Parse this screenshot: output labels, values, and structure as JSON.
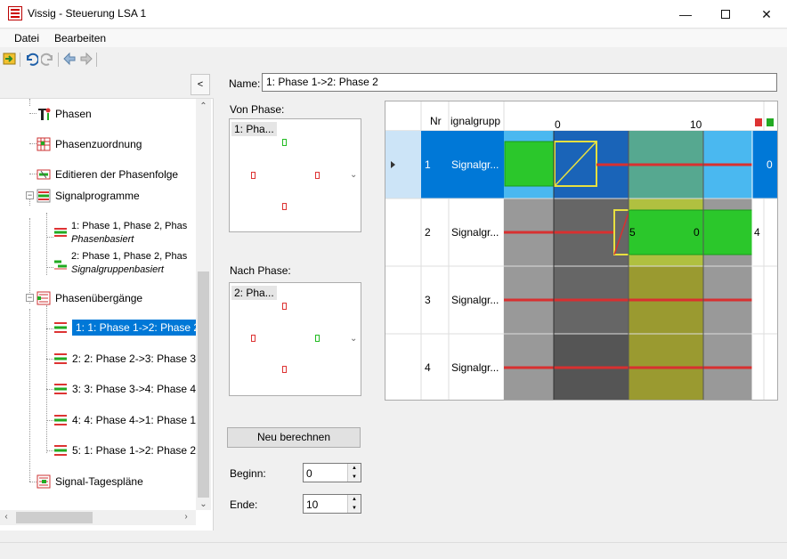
{
  "window": {
    "title": "Vissig - Steuerung LSA 1"
  },
  "menu": {
    "items": [
      "Datei",
      "Bearbeiten"
    ]
  },
  "toolbar": {
    "buttons": [
      "exit-icon",
      "undo-icon",
      "redo-icon",
      "back-icon",
      "forward-icon"
    ]
  },
  "left_panel": {
    "collapse_label": "<",
    "tree": [
      {
        "label": "Phasen"
      },
      {
        "label": "Phasenzuordnung"
      },
      {
        "label": "Editieren der Phasenfolge"
      },
      {
        "label": "Signalprogramme"
      },
      {
        "label": "1: Phase 1, Phase 2, Phas",
        "sub": "Phasenbasiert"
      },
      {
        "label": "2: Phase 1, Phase 2, Phas",
        "sub": "Signalgruppenbasiert"
      },
      {
        "label": "Phasenübergänge"
      },
      {
        "label": "1: 1: Phase 1->2: Phase 2",
        "selected": true
      },
      {
        "label": "2: 2: Phase 2->3: Phase 3"
      },
      {
        "label": "3: 3: Phase 3->4: Phase 4"
      },
      {
        "label": "4: 4: Phase 4->1: Phase 1"
      },
      {
        "label": "5: 1: Phase 1->2: Phase 2"
      },
      {
        "label": "Signal-Tagespläne"
      }
    ]
  },
  "editor": {
    "name_label": "Name:",
    "name_value": "1: Phase 1->2: Phase 2",
    "von_label": "Von Phase:",
    "von_title": "1: Pha...",
    "nach_label": "Nach Phase:",
    "nach_title": "2: Pha...",
    "recalc_label": "Neu berechnen",
    "begin_label": "Beginn:",
    "begin_value": "0",
    "end_label": "Ende:",
    "end_value": "10"
  },
  "grid": {
    "headers": {
      "nr": "Nr",
      "group": "ignalgrupp",
      "tick_0": "0",
      "tick_10": "10"
    },
    "rows": [
      {
        "nr": "1",
        "group": "Signalgr...",
        "end_value": "0"
      },
      {
        "nr": "2",
        "group": "Signalgr...",
        "bar_start": "5",
        "bar_end": "0",
        "end_value": "4"
      },
      {
        "nr": "3",
        "group": "Signalgr..."
      },
      {
        "nr": "4",
        "group": "Signalgr..."
      }
    ]
  },
  "colors": {
    "selection": "#0078d7",
    "green": "#2bc72b",
    "red": "#d83030",
    "yellow": "#b8b830"
  }
}
